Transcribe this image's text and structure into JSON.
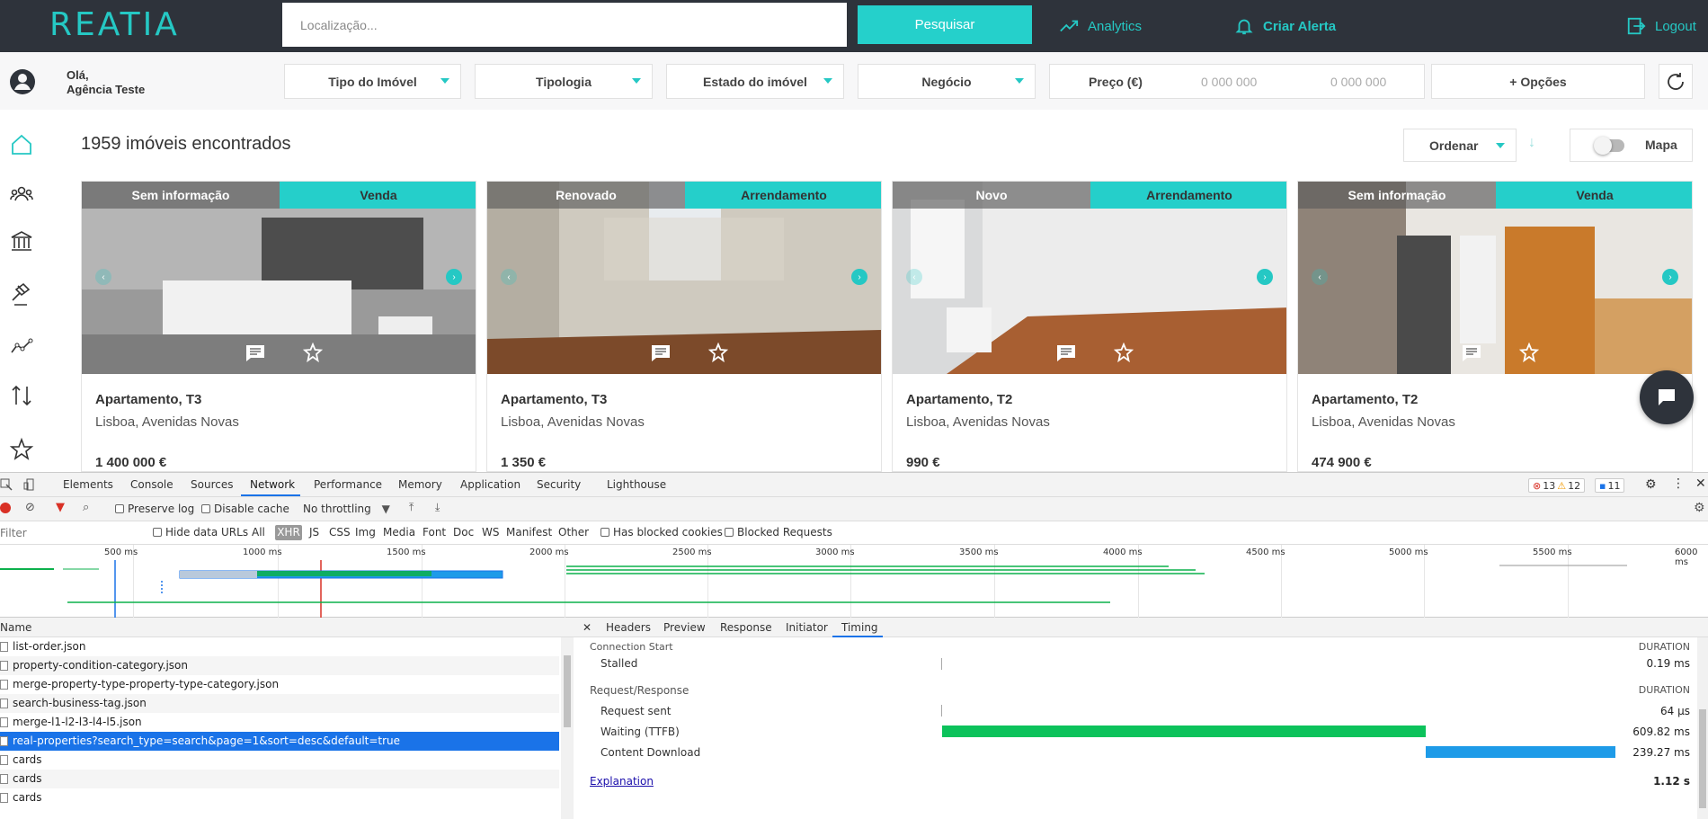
{
  "header": {
    "logo": "REATIA",
    "location_placeholder": "Localização...",
    "search_label": "Pesquisar",
    "analytics_label": "Analytics",
    "alert_label": "Criar Alerta",
    "logout_label": "Logout",
    "accent_color": "#25c8c4"
  },
  "user": {
    "greeting": "Olá,",
    "name": "Agência Teste"
  },
  "filters": {
    "property_type": "Tipo do Imóvel",
    "typology": "Tipologia",
    "condition": "Estado do imóvel",
    "business": "Negócio",
    "price_label": "Preço (€)",
    "price_min_placeholder": "0 000 000",
    "price_max_placeholder": "0 000 000",
    "options": "+ Opções"
  },
  "results": {
    "count_text": "1959 imóveis encontrados",
    "sort_label": "Ordenar",
    "map_label": "Mapa"
  },
  "cards": [
    {
      "condition": "Sem informação",
      "business": "Venda",
      "title": "Apartamento, T3",
      "location": "Lisboa, Avenidas Novas",
      "price": "1 400 000 €"
    },
    {
      "condition": "Renovado",
      "business": "Arrendamento",
      "title": "Apartamento, T3",
      "location": "Lisboa, Avenidas Novas",
      "price": "1 350 €"
    },
    {
      "condition": "Novo",
      "business": "Arrendamento",
      "title": "Apartamento, T2",
      "location": "Lisboa, Avenidas Novas",
      "price": "990 €"
    },
    {
      "condition": "Sem informação",
      "business": "Venda",
      "title": "Apartamento, T2",
      "location": "Lisboa, Avenidas Novas",
      "price": "474 900 €"
    }
  ],
  "devtools": {
    "tabs": [
      "Elements",
      "Console",
      "Sources",
      "Network",
      "Performance",
      "Memory",
      "Application",
      "Security",
      "Lighthouse"
    ],
    "active_tab": "Network",
    "errors": "13",
    "warnings": "12",
    "messages": "11",
    "toolbar": {
      "preserve_log": "Preserve log",
      "disable_cache": "Disable cache",
      "throttling": "No throttling"
    },
    "filter": {
      "placeholder": "Filter",
      "hide_data_urls": "Hide data URLs",
      "types": [
        "All",
        "XHR",
        "JS",
        "CSS",
        "Img",
        "Media",
        "Font",
        "Doc",
        "WS",
        "Manifest",
        "Other"
      ],
      "has_blocked_cookies": "Has blocked cookies",
      "blocked_requests": "Blocked Requests"
    },
    "timeline_ticks": [
      "500 ms",
      "1000 ms",
      "1500 ms",
      "2000 ms",
      "2500 ms",
      "3000 ms",
      "3500 ms",
      "4000 ms",
      "4500 ms",
      "5000 ms",
      "5500 ms",
      "6000 ms"
    ],
    "name_header": "Name",
    "requests": [
      "list-order.json",
      "property-condition-category.json",
      "merge-property-type-property-type-category.json",
      "search-business-tag.json",
      "merge-l1-l2-l3-l4-l5.json",
      "real-properties?search_type=search&page=1&sort=desc&default=true",
      "cards",
      "cards",
      "cards"
    ],
    "detail_tabs": [
      "Headers",
      "Preview",
      "Response",
      "Initiator",
      "Timing"
    ],
    "active_detail_tab": "Timing",
    "timing": {
      "conn_start_label": "Connection Start",
      "duration_label": "DURATION",
      "stalled_label": "Stalled",
      "stalled_value": "0.19 ms",
      "reqresp_label": "Request/Response",
      "request_sent_label": "Request sent",
      "request_sent_value": "64 μs",
      "ttfb_label": "Waiting (TTFB)",
      "ttfb_value": "609.82 ms",
      "download_label": "Content Download",
      "download_value": "239.27 ms",
      "explanation": "Explanation",
      "total_value": "1.12 s"
    }
  }
}
